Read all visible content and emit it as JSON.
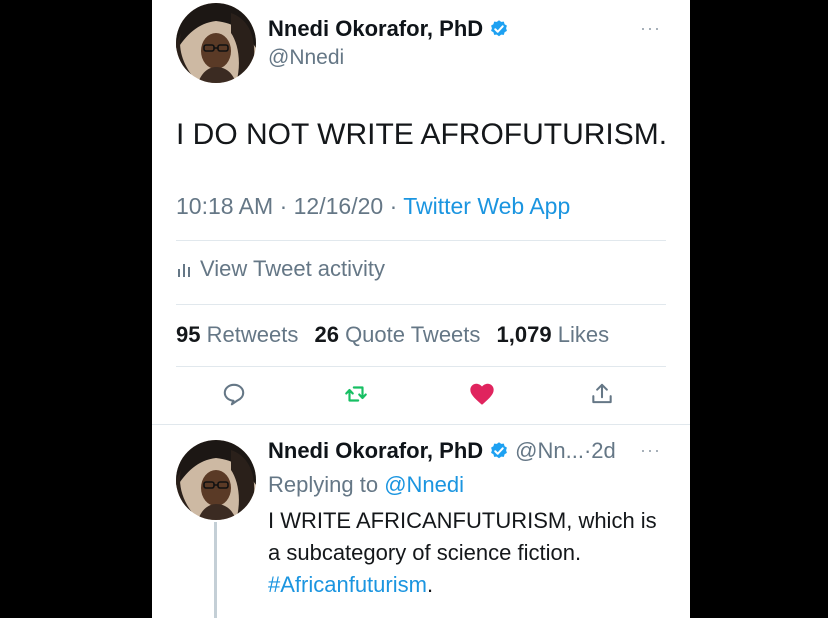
{
  "tweet": {
    "author_name": "Nnedi Okorafor, PhD",
    "handle": "@Nnedi",
    "text": "I DO NOT WRITE AFROFUTURISM.",
    "time": "10:18 AM",
    "date": "12/16/20",
    "sep": "·",
    "source": "Twitter Web App",
    "activity_label": "View Tweet activity",
    "retweets_count": "95",
    "retweets_label": "Retweets",
    "quotes_count": "26",
    "quotes_label": "Quote Tweets",
    "likes_count": "1,079",
    "likes_label": "Likes",
    "more": "···"
  },
  "reply": {
    "author_name": "Nnedi Okorafor, PhD",
    "handle": "@Nn...",
    "sep": "·",
    "age": "2d",
    "replying_prefix": "Replying to",
    "replying_to": "@Nnedi",
    "text_line1": "I WRITE AFRICANFUTURISM, which is",
    "text_line2": "a subcategory of science fiction.",
    "hashtag": "#Africanfuturism",
    "hashtag_suffix": ".",
    "more": "···"
  },
  "colors": {
    "link": "#1b95e0",
    "secondary": "#657786",
    "retweet": "#17bf63",
    "like": "#e0245e"
  },
  "icons": {
    "verified": "verified-badge-icon",
    "activity": "bar-chart-icon",
    "reply": "reply-icon",
    "retweet": "retweet-icon",
    "like": "heart-icon",
    "share": "share-icon"
  }
}
